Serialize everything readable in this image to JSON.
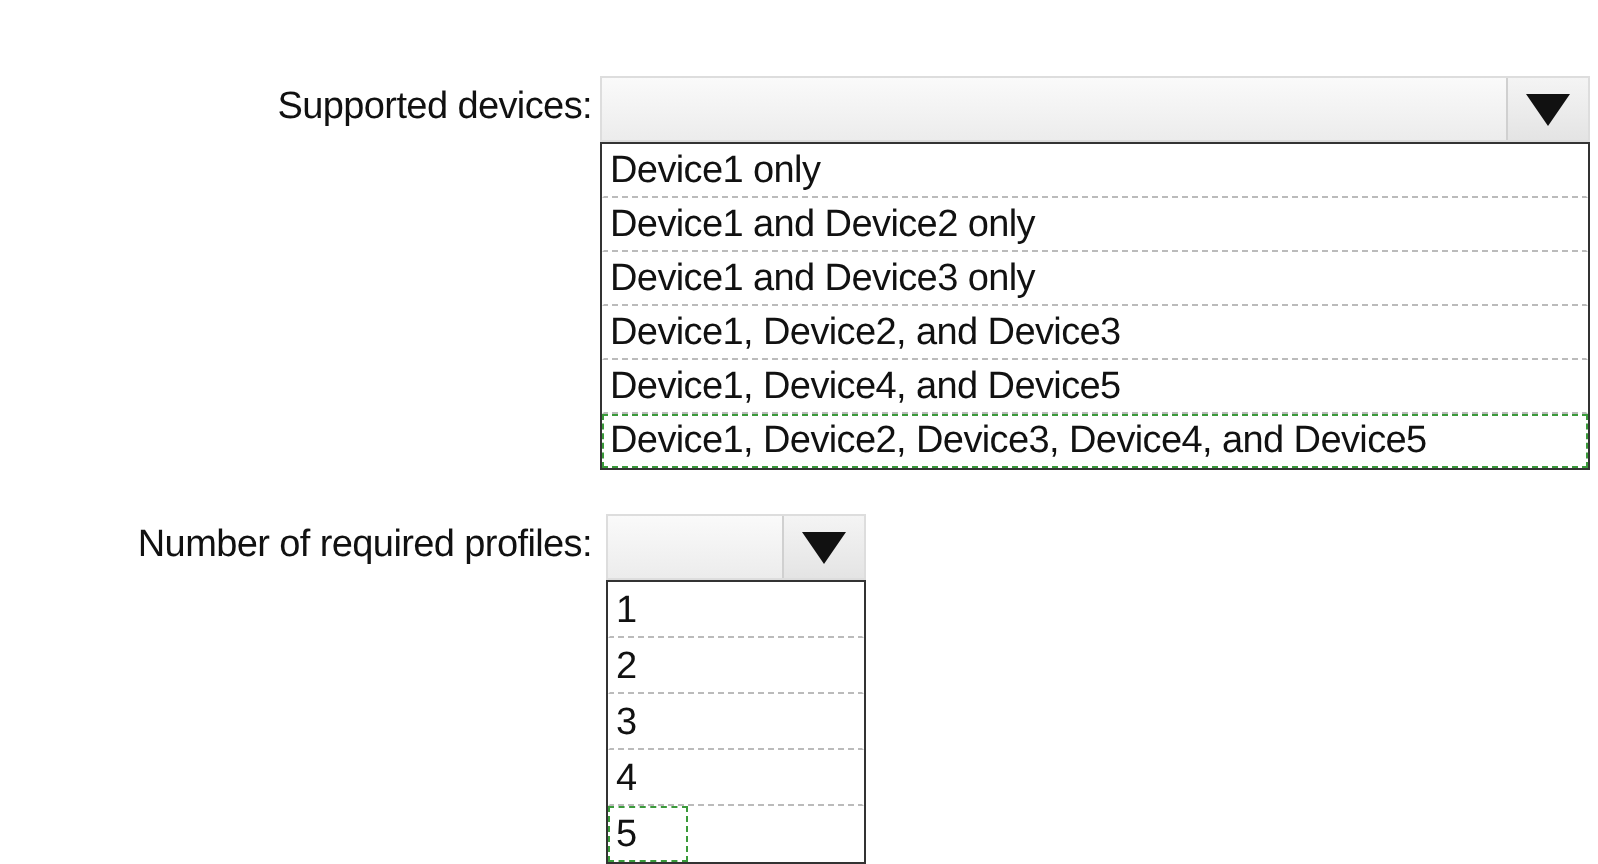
{
  "questions": [
    {
      "label": "Supported devices:",
      "options": [
        {
          "text": "Device1 only",
          "selected": false
        },
        {
          "text": "Device1 and Device2 only",
          "selected": false
        },
        {
          "text": "Device1 and Device3 only",
          "selected": false
        },
        {
          "text": "Device1, Device2, and Device3",
          "selected": false
        },
        {
          "text": "Device1, Device4, and Device5",
          "selected": false
        },
        {
          "text": "Device1, Device2, Device3, Device4, and Device5",
          "selected": true
        }
      ]
    },
    {
      "label": "Number of required profiles:",
      "options": [
        {
          "text": "1",
          "selected": false
        },
        {
          "text": "2",
          "selected": false
        },
        {
          "text": "3",
          "selected": false
        },
        {
          "text": "4",
          "selected": false
        },
        {
          "text": "5",
          "selected": true
        }
      ]
    }
  ]
}
